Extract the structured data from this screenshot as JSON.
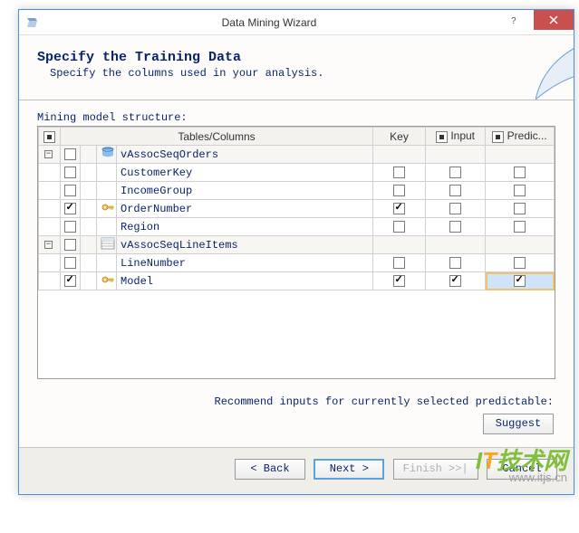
{
  "window": {
    "title": "Data Mining Wizard"
  },
  "header": {
    "title": "Specify the Training Data",
    "subtitle": "Specify the columns used in your analysis."
  },
  "structure_label": "Mining model structure:",
  "columns": {
    "name": "Tables/Columns",
    "key": "Key",
    "input": "Input",
    "predict": "Predic..."
  },
  "rows": [
    {
      "type": "table",
      "label": "vAssocSeqOrders",
      "icon": "case-table",
      "include": false
    },
    {
      "type": "col",
      "label": "CustomerKey",
      "icon": "",
      "include": false,
      "key": false,
      "input": false,
      "predict": false
    },
    {
      "type": "col",
      "label": "IncomeGroup",
      "icon": "",
      "include": false,
      "key": false,
      "input": false,
      "predict": false
    },
    {
      "type": "col",
      "label": "OrderNumber",
      "icon": "key",
      "include": true,
      "key": true,
      "input": false,
      "predict": false
    },
    {
      "type": "col",
      "label": "Region",
      "icon": "",
      "include": false,
      "key": false,
      "input": false,
      "predict": false
    },
    {
      "type": "table",
      "label": "vAssocSeqLineItems",
      "icon": "nested-table",
      "include": false
    },
    {
      "type": "col",
      "label": "LineNumber",
      "icon": "",
      "include": false,
      "key": false,
      "input": false,
      "predict": false
    },
    {
      "type": "col",
      "label": "Model",
      "icon": "key",
      "include": true,
      "key": true,
      "input": true,
      "predict": true,
      "predict_selected": true
    }
  ],
  "recommend_label": "Recommend inputs for currently selected predictable:",
  "buttons": {
    "suggest": "Suggest",
    "back": "< Back",
    "next": "Next >",
    "finish": "Finish >>|",
    "cancel": "Cancel"
  },
  "watermark": {
    "brand_prefix": "I",
    "brand_o": "T",
    "brand_rest": "技术网",
    "url": "www.itjs.cn"
  }
}
